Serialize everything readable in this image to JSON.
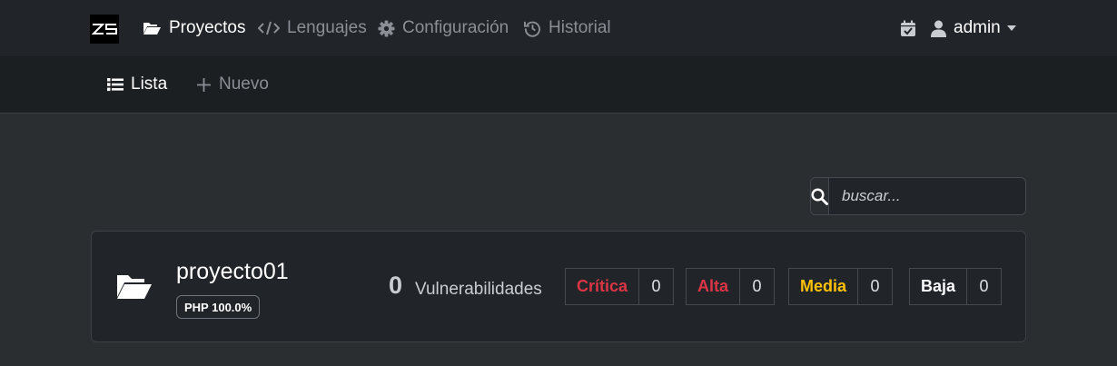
{
  "topnav": {
    "logo_text": "ZS",
    "items": [
      {
        "label": "Proyectos",
        "icon": "folder-open-icon"
      },
      {
        "label": "Lenguajes",
        "icon": "code-icon"
      },
      {
        "label": "Configuración",
        "icon": "gear-icon"
      },
      {
        "label": "Historial",
        "icon": "history-icon"
      }
    ],
    "user": "admin"
  },
  "subnav": {
    "items": [
      {
        "label": "Lista",
        "icon": "list-icon"
      },
      {
        "label": "Nuevo",
        "icon": "plus-icon"
      }
    ]
  },
  "search": {
    "placeholder": "buscar..."
  },
  "projects": [
    {
      "name": "proyecto01",
      "language_badge": "PHP 100.0%",
      "vuln_count": "0",
      "vuln_label": "Vulnerabilidades",
      "severities": [
        {
          "label": "Crítica",
          "value": "0",
          "color": "#dc3545"
        },
        {
          "label": "Alta",
          "value": "0",
          "color": "#dc3545"
        },
        {
          "label": "Media",
          "value": "0",
          "color": "#ffc107"
        },
        {
          "label": "Baja",
          "value": "0",
          "color": "#f8f9fa"
        }
      ]
    }
  ]
}
